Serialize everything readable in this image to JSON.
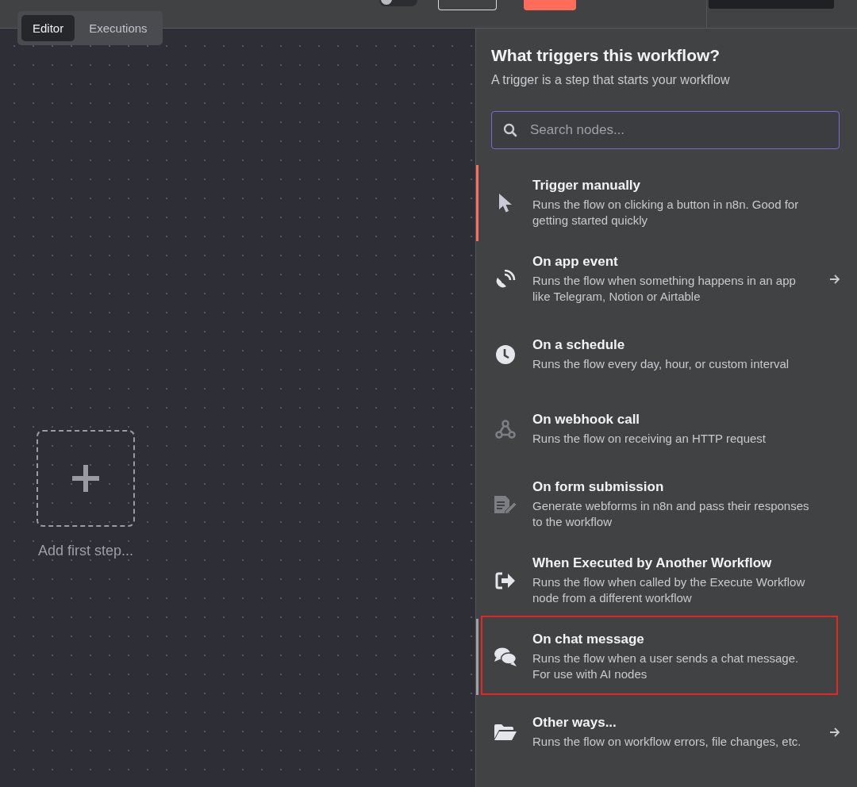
{
  "header": {
    "toggle": {
      "on": false
    }
  },
  "view_tabs": [
    {
      "label": "Editor",
      "selected": true
    },
    {
      "label": "Executions",
      "selected": false
    }
  ],
  "canvas": {
    "add_step_label": "Add first step..."
  },
  "panel": {
    "title": "What triggers this workflow?",
    "subtitle": "A trigger is a step that starts your workflow",
    "search": {
      "placeholder": "Search nodes..."
    },
    "items": [
      {
        "kind": "cursor",
        "title": "Trigger manually",
        "description": "Runs the flow on clicking a button in n8n. Good for getting started quickly",
        "selected": true,
        "hovered": false,
        "highlighted": false,
        "has_submenu": false
      },
      {
        "kind": "satellite",
        "title": "On app event",
        "description": "Runs the flow when something happens in an app like Telegram, Notion or Airtable",
        "selected": false,
        "hovered": false,
        "highlighted": false,
        "has_submenu": true
      },
      {
        "kind": "clock",
        "title": "On a schedule",
        "description": "Runs the flow every day, hour, or custom interval",
        "selected": false,
        "hovered": false,
        "highlighted": false,
        "has_submenu": false
      },
      {
        "kind": "webhook",
        "title": "On webhook call",
        "description": "Runs the flow on receiving an HTTP request",
        "selected": false,
        "hovered": false,
        "highlighted": false,
        "has_submenu": false
      },
      {
        "kind": "form",
        "title": "On form submission",
        "description": "Generate webforms in n8n and pass their responses to the workflow",
        "selected": false,
        "hovered": false,
        "highlighted": false,
        "has_submenu": false
      },
      {
        "kind": "exit",
        "title": "When Executed by Another Workflow",
        "description": "Runs the flow when called by the Execute Workflow node from a different workflow",
        "selected": false,
        "hovered": false,
        "highlighted": false,
        "has_submenu": false
      },
      {
        "kind": "chat",
        "title": "On chat message",
        "description": "Runs the flow when a user sends a chat message. For use with AI nodes",
        "selected": false,
        "hovered": true,
        "highlighted": true,
        "has_submenu": false
      },
      {
        "kind": "folder",
        "title": "Other ways...",
        "description": "Runs the flow on workflow errors, file changes, etc.",
        "selected": false,
        "hovered": false,
        "highlighted": false,
        "has_submenu": true
      }
    ]
  }
}
